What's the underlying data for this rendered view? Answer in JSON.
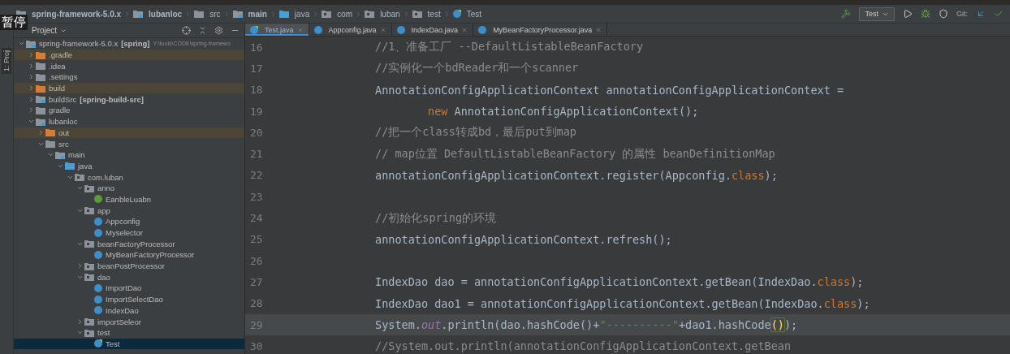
{
  "overlay_label": "暂停",
  "breadcrumbs": [
    {
      "label": "spring-framework-5.0.x",
      "kind": "module"
    },
    {
      "label": "lubanloc",
      "kind": "module"
    },
    {
      "label": "src",
      "kind": "folder"
    },
    {
      "label": "main",
      "kind": "module"
    },
    {
      "label": "java",
      "kind": "source"
    },
    {
      "label": "com",
      "kind": "package"
    },
    {
      "label": "luban",
      "kind": "package"
    },
    {
      "label": "test",
      "kind": "package"
    },
    {
      "label": "Test",
      "kind": "testclass"
    }
  ],
  "toolbar": {
    "run_config": "Test",
    "git_label": "Git:"
  },
  "tool_stripe": {
    "label": "1: Proj"
  },
  "project_panel": {
    "title": "Project",
    "tree": [
      {
        "label": "spring-framework-5.0.x",
        "module": "[spring]",
        "path": "Y:\\tools\\CODE\\spring-framewo",
        "kind": "module",
        "expanded": true,
        "selected": false,
        "children": [
          {
            "label": ".gradle",
            "kind": "excluded",
            "expanded": false,
            "selected": false
          },
          {
            "label": ".idea",
            "kind": "folder",
            "expanded": false,
            "selected": false
          },
          {
            "label": ".settings",
            "kind": "folder",
            "expanded": false,
            "selected": false
          },
          {
            "label": "build",
            "kind": "excluded",
            "expanded": false,
            "selected": false
          },
          {
            "label": "buildSrc",
            "module": "[spring-build-src]",
            "kind": "module",
            "expanded": false,
            "selected": false
          },
          {
            "label": "gradle",
            "kind": "folder",
            "expanded": false,
            "selected": false
          },
          {
            "label": "lubanloc",
            "kind": "module",
            "expanded": true,
            "selected": false,
            "children": [
              {
                "label": "out",
                "kind": "excluded",
                "expanded": false,
                "selected": false
              },
              {
                "label": "src",
                "kind": "folder",
                "expanded": true,
                "selected": false,
                "children": [
                  {
                    "label": "main",
                    "kind": "module",
                    "expanded": true,
                    "selected": false,
                    "children": [
                      {
                        "label": "java",
                        "kind": "source",
                        "expanded": true,
                        "selected": false,
                        "children": [
                          {
                            "label": "com.luban",
                            "kind": "package",
                            "expanded": true,
                            "selected": false,
                            "children": [
                              {
                                "label": "anno",
                                "kind": "package",
                                "expanded": true,
                                "selected": false,
                                "children": [
                                  {
                                    "label": "EanbleLuabn",
                                    "kind": "annotation",
                                    "selected": false
                                  }
                                ]
                              },
                              {
                                "label": "app",
                                "kind": "package",
                                "expanded": true,
                                "selected": false,
                                "children": [
                                  {
                                    "label": "Appconfig",
                                    "kind": "class",
                                    "selected": false
                                  },
                                  {
                                    "label": "Myselector",
                                    "kind": "class",
                                    "selected": false
                                  }
                                ]
                              },
                              {
                                "label": "beanFactoryProcessor",
                                "kind": "package",
                                "expanded": true,
                                "selected": false,
                                "children": [
                                  {
                                    "label": "MyBeanFactoryProcessor",
                                    "kind": "class",
                                    "selected": false
                                  }
                                ]
                              },
                              {
                                "label": "beanPostProcessor",
                                "kind": "package",
                                "expanded": false,
                                "selected": false
                              },
                              {
                                "label": "dao",
                                "kind": "package",
                                "expanded": true,
                                "selected": false,
                                "children": [
                                  {
                                    "label": "ImportDao",
                                    "kind": "class",
                                    "selected": false
                                  },
                                  {
                                    "label": "ImportSelectDao",
                                    "kind": "class",
                                    "selected": false
                                  },
                                  {
                                    "label": "IndexDao",
                                    "kind": "class",
                                    "selected": false
                                  }
                                ]
                              },
                              {
                                "label": "importSeleor",
                                "kind": "package",
                                "expanded": false,
                                "selected": false
                              },
                              {
                                "label": "test",
                                "kind": "package",
                                "expanded": true,
                                "selected": false,
                                "children": [
                                  {
                                    "label": "Test",
                                    "kind": "testclass",
                                    "selected": true
                                  }
                                ]
                              }
                            ]
                          }
                        ]
                      }
                    ]
                  }
                ]
              }
            ]
          }
        ]
      }
    ]
  },
  "editor": {
    "tabs": [
      {
        "label": "Test.java",
        "kind": "testclass",
        "selected": true
      },
      {
        "label": "Appconfig.java",
        "kind": "class",
        "selected": false
      },
      {
        "label": "IndexDao.java",
        "kind": "class",
        "selected": false
      },
      {
        "label": "MyBeanFactoryProcessor.java",
        "kind": "class",
        "selected": false
      }
    ],
    "lines": [
      {
        "number": "16",
        "current": false,
        "segments": [
          {
            "t": "//1、准备工厂 --DefaultListableBeanFactory",
            "kind": "comment"
          }
        ]
      },
      {
        "number": "17",
        "current": false,
        "segments": [
          {
            "t": "//实例化一个bdReader和一个scanner",
            "kind": "comment"
          }
        ]
      },
      {
        "number": "18",
        "current": false,
        "segments": [
          {
            "t": "AnnotationConfigApplicationContext annotationConfigApplicationContext =",
            "kind": "plain"
          }
        ]
      },
      {
        "number": "19",
        "current": false,
        "segments": [
          {
            "t": "        new",
            "kind": "keyword"
          },
          {
            "t": " AnnotationConfigApplicationContext();",
            "kind": "plain"
          }
        ]
      },
      {
        "number": "20",
        "current": false,
        "segments": [
          {
            "t": "//把一个class转成bd，最后put到map",
            "kind": "comment"
          }
        ]
      },
      {
        "number": "21",
        "current": false,
        "segments": [
          {
            "t": "// map位置 DefaultListableBeanFactory 的属性 beanDefinitionMap",
            "kind": "comment"
          }
        ]
      },
      {
        "number": "22",
        "current": false,
        "segments": [
          {
            "t": "annotationConfigApplicationContext.register(Appconfig.",
            "kind": "plain"
          },
          {
            "t": "class",
            "kind": "keyword"
          },
          {
            "t": ");",
            "kind": "plain"
          }
        ]
      },
      {
        "number": "23",
        "current": false
      },
      {
        "number": "24",
        "current": false,
        "segments": [
          {
            "t": "//初始化spring的环境",
            "kind": "comment"
          }
        ]
      },
      {
        "number": "25",
        "current": false,
        "segments": [
          {
            "t": "annotationConfigApplicationContext.refresh();",
            "kind": "plain"
          }
        ]
      },
      {
        "number": "26",
        "current": false
      },
      {
        "number": "27",
        "current": false,
        "segments": [
          {
            "t": "IndexDao dao = annotationConfigApplicationContext.getBean(IndexDao.",
            "kind": "plain"
          },
          {
            "t": "class",
            "kind": "keyword"
          },
          {
            "t": ");",
            "kind": "plain"
          }
        ]
      },
      {
        "number": "28",
        "current": false,
        "segments": [
          {
            "t": "IndexDao dao1 = annotationConfigApplicationContext.getBean(IndexDao.",
            "kind": "plain"
          },
          {
            "t": "class",
            "kind": "keyword"
          },
          {
            "t": ");",
            "kind": "plain"
          }
        ]
      },
      {
        "number": "29",
        "current": true,
        "segments": [
          {
            "t": "System.",
            "kind": "plain"
          },
          {
            "t": "out",
            "kind": "field"
          },
          {
            "t": ".println(dao.hashCode()+",
            "kind": "plain"
          },
          {
            "t": "\"----------\"",
            "kind": "string"
          },
          {
            "t": "+dao1.hashCode",
            "kind": "plain"
          },
          {
            "t": "()",
            "kind": "match"
          },
          {
            "t": ");",
            "kind": "plain"
          }
        ]
      },
      {
        "number": "30",
        "current": false,
        "segments": [
          {
            "t": "//System.out.println(annotationConfigApplicationContext.getBean",
            "kind": "comment"
          }
        ]
      }
    ]
  }
}
